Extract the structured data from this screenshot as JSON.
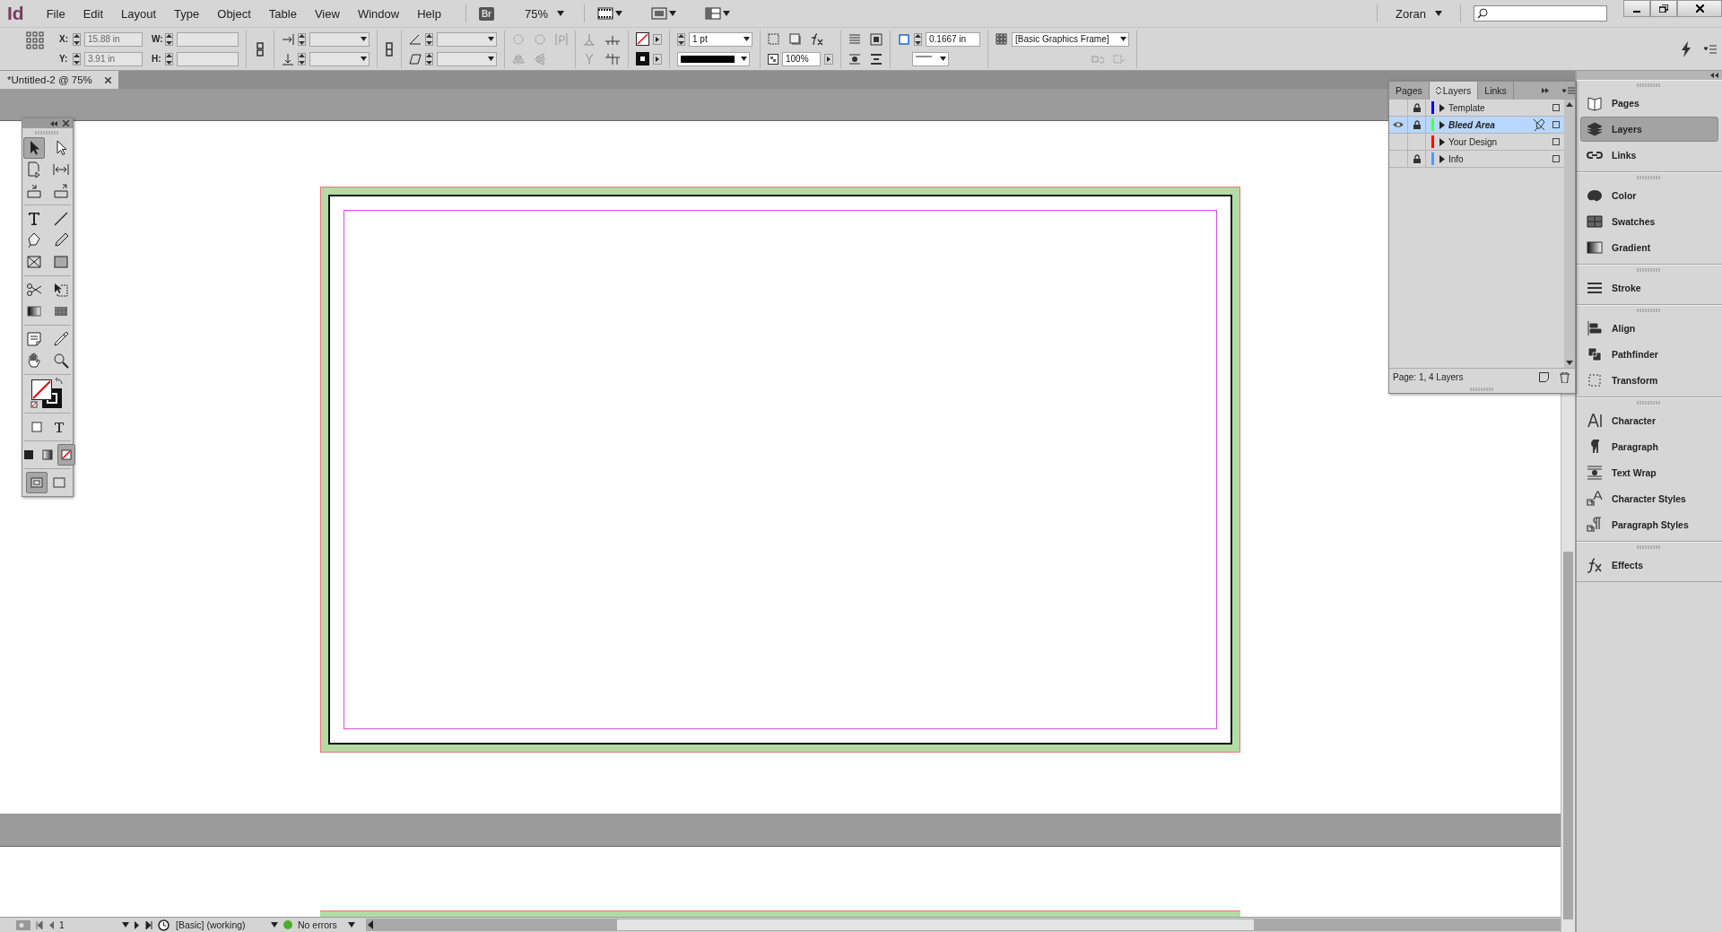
{
  "app": {
    "logo": "Id",
    "bridge": "Br",
    "zoom": "75%",
    "user": "Zoran"
  },
  "menu": [
    "File",
    "Edit",
    "Layout",
    "Type",
    "Object",
    "Table",
    "View",
    "Window",
    "Help"
  ],
  "control_bar": {
    "x": {
      "label": "X:",
      "value": "15.88 in"
    },
    "y": {
      "label": "Y:",
      "value": "3.91 in"
    },
    "w": {
      "label": "W:"
    },
    "h": {
      "label": "H:"
    },
    "stroke_weight": "1 pt",
    "opacity": "100%",
    "fitting_offset": "0.1667 in",
    "object_style": "[Basic Graphics Frame]"
  },
  "document_tab": {
    "title": "*Untitled-2 @ 75%"
  },
  "tools": [
    [
      {
        "kind": "selection",
        "selected": true
      },
      {
        "kind": "direct-selection",
        "selected": false
      }
    ],
    [
      {
        "kind": "page",
        "selected": false
      },
      {
        "kind": "gap",
        "selected": false
      }
    ],
    [
      {
        "kind": "collector",
        "selected": false
      },
      {
        "kind": "placer",
        "selected": false
      }
    ],
    [
      {
        "kind": "type",
        "selected": false
      },
      {
        "kind": "line",
        "selected": false
      }
    ],
    [
      {
        "kind": "pen",
        "selected": false
      },
      {
        "kind": "pencil",
        "selected": false
      }
    ],
    [
      {
        "kind": "frame",
        "selected": false
      },
      {
        "kind": "rectangle",
        "selected": false
      }
    ],
    [
      {
        "kind": "scissors",
        "selected": false
      },
      {
        "kind": "free-transform",
        "selected": false
      }
    ],
    [
      {
        "kind": "gradient",
        "selected": false
      },
      {
        "kind": "feather",
        "selected": false
      }
    ],
    [
      {
        "kind": "note",
        "selected": false
      },
      {
        "kind": "eyedropper",
        "selected": false
      }
    ],
    [
      {
        "kind": "hand",
        "selected": false
      },
      {
        "kind": "zoom",
        "selected": false
      }
    ]
  ],
  "format_buttons": [
    {
      "kind": "container",
      "selected": false
    },
    {
      "kind": "text",
      "selected": false
    }
  ],
  "apply_buttons": [
    {
      "kind": "color",
      "selected": false
    },
    {
      "kind": "gradient",
      "selected": false
    },
    {
      "kind": "none",
      "selected": true
    }
  ],
  "view_modes": [
    {
      "kind": "normal",
      "selected": true
    },
    {
      "kind": "preview",
      "selected": false
    }
  ],
  "layers_panel": {
    "tabs": [
      {
        "label": "Pages",
        "selected": false
      },
      {
        "label": "Layers",
        "selected": true
      },
      {
        "label": "Links",
        "selected": false
      }
    ],
    "layers": [
      {
        "name": "Template",
        "color": "#0000ff",
        "visible": false,
        "locked": true,
        "selected": false
      },
      {
        "name": "Bleed Area",
        "color": "#4cff4c",
        "visible": true,
        "locked": true,
        "selected": true
      },
      {
        "name": "Your Design",
        "color": "#ff0000",
        "visible": false,
        "locked": false,
        "selected": false
      },
      {
        "name": "Info",
        "color": "#4f99ff",
        "visible": false,
        "locked": true,
        "selected": false
      }
    ],
    "footer": "Page: 1, 4 Layers"
  },
  "dock": [
    [
      {
        "label": "Pages",
        "kind": "pages",
        "selected": false
      },
      {
        "label": "Layers",
        "kind": "layers",
        "selected": true
      },
      {
        "label": "Links",
        "kind": "links",
        "selected": false
      }
    ],
    [
      {
        "label": "Color",
        "kind": "color",
        "selected": false
      },
      {
        "label": "Swatches",
        "kind": "swatches",
        "selected": false
      },
      {
        "label": "Gradient",
        "kind": "gradient",
        "selected": false
      }
    ],
    [
      {
        "label": "Stroke",
        "kind": "stroke",
        "selected": false
      }
    ],
    [
      {
        "label": "Align",
        "kind": "align",
        "selected": false
      },
      {
        "label": "Pathfinder",
        "kind": "pathfinder",
        "selected": false
      },
      {
        "label": "Transform",
        "kind": "transform",
        "selected": false
      }
    ],
    [
      {
        "label": "Character",
        "kind": "character",
        "selected": false
      },
      {
        "label": "Paragraph",
        "kind": "paragraph",
        "selected": false
      },
      {
        "label": "Text Wrap",
        "kind": "textwrap",
        "selected": false
      },
      {
        "label": "Character Styles",
        "kind": "charstyles",
        "selected": false
      },
      {
        "label": "Paragraph Styles",
        "kind": "parastyles",
        "selected": false
      }
    ],
    [
      {
        "label": "Effects",
        "kind": "effects",
        "selected": false
      }
    ]
  ],
  "status_bar": {
    "page": "1",
    "style": "[Basic] (working)",
    "preflight": "No errors",
    "preflight_ok": true
  }
}
